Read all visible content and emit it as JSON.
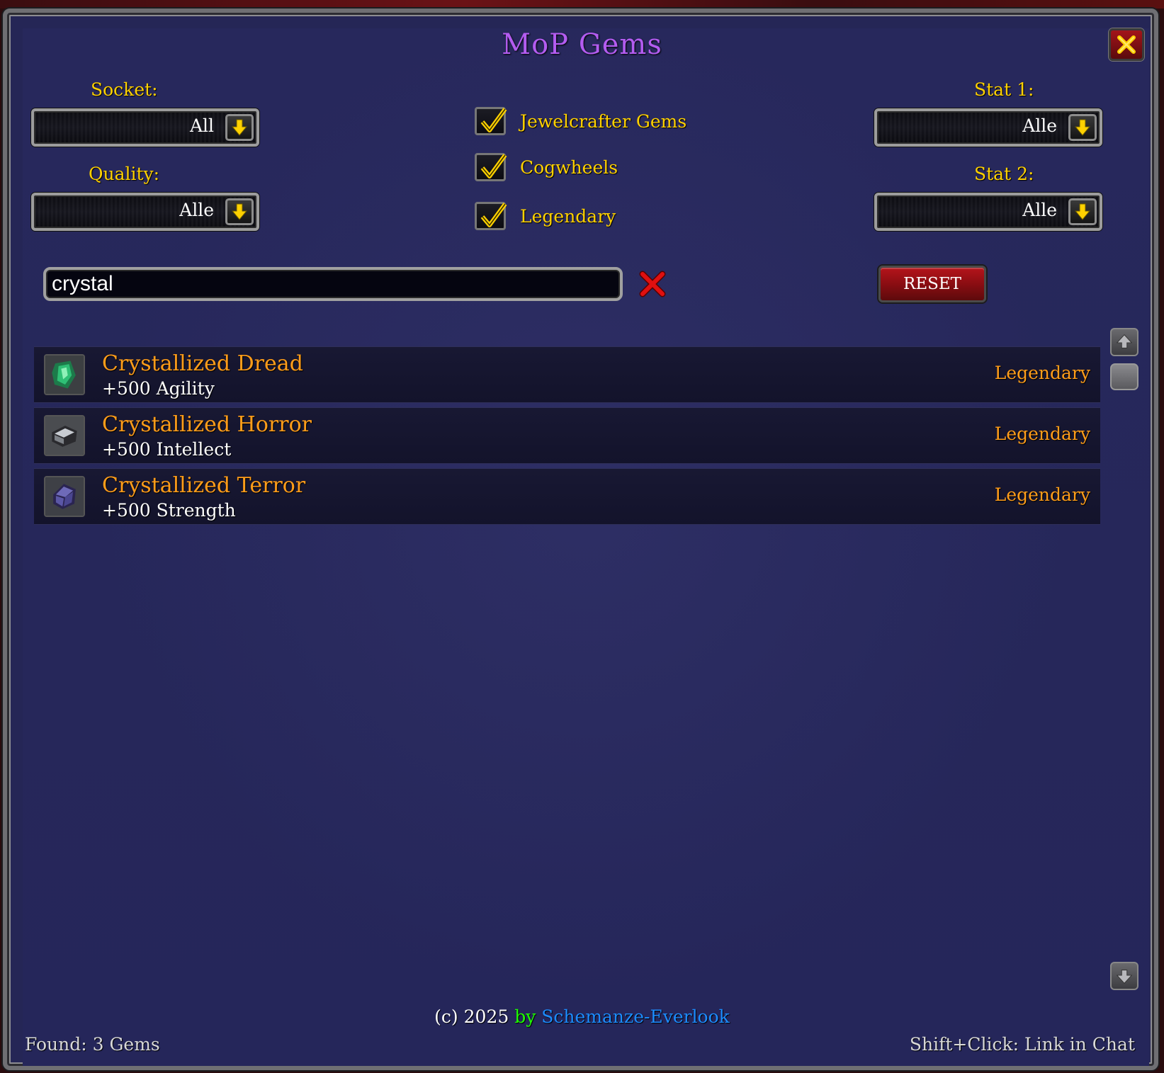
{
  "window": {
    "title": "MoP Gems"
  },
  "filters": {
    "socket": {
      "label": "Socket:",
      "value": "All"
    },
    "quality": {
      "label": "Quality:",
      "value": "Alle"
    },
    "stat1": {
      "label": "Stat 1:",
      "value": "Alle"
    },
    "stat2": {
      "label": "Stat 2:",
      "value": "Alle"
    }
  },
  "checkboxes": [
    {
      "label": "Jewelcrafter Gems",
      "checked": true
    },
    {
      "label": "Cogwheels",
      "checked": true
    },
    {
      "label": "Legendary",
      "checked": true
    }
  ],
  "search": {
    "value": "crystal"
  },
  "reset_label": "RESET",
  "results": [
    {
      "name": "Crystallized Dread",
      "stat": "+500 Agility",
      "quality": "Legendary",
      "icon": "green-crystal-gem-icon"
    },
    {
      "name": "Crystallized Horror",
      "stat": "+500 Intellect",
      "quality": "Legendary",
      "icon": "silver-crystal-gem-icon"
    },
    {
      "name": "Crystallized Terror",
      "stat": "+500 Strength",
      "quality": "Legendary",
      "icon": "purple-crystal-gem-icon"
    }
  ],
  "footer": {
    "copyright": "(c) 2025",
    "by": "by",
    "author": "Schemanze-Everlook",
    "found": "Found: 3 Gems",
    "hint": "Shift+Click: Link in Chat"
  },
  "colors": {
    "title": "#b35cf0",
    "label": "#ffd100",
    "legendary": "#ff9d1a",
    "by": "#1eff00",
    "author": "#1c8cff",
    "panel": "#26275a"
  }
}
